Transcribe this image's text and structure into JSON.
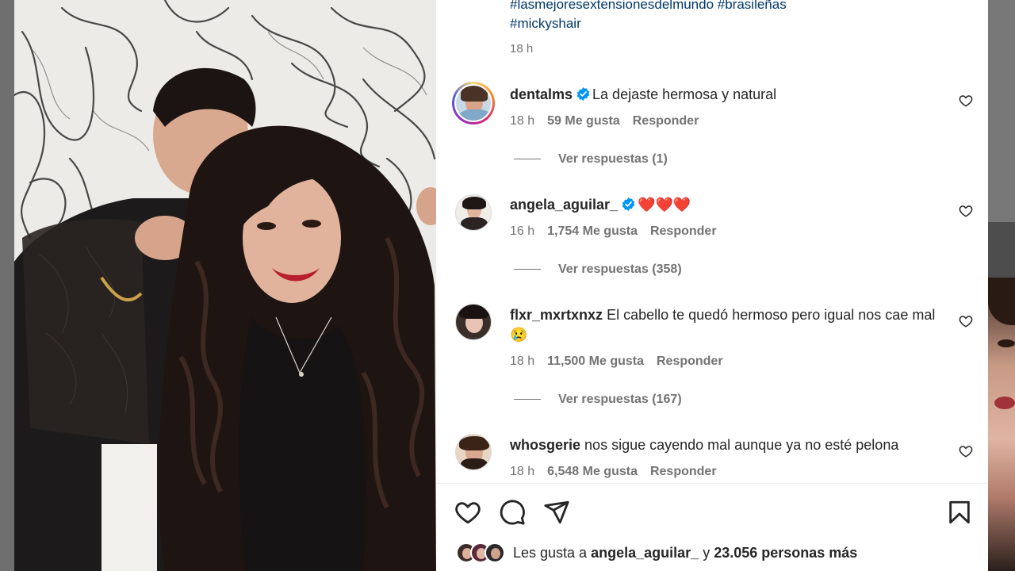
{
  "caption": {
    "hashtags": [
      "#lasmejoresextensionesdelmundo #brasileñas",
      "#mickyshair"
    ],
    "time": "18 h"
  },
  "comments": [
    {
      "username": "dentalms",
      "verified": true,
      "text": "La dejaste hermosa y natural",
      "time": "18 h",
      "likes": "59 Me gusta",
      "reply": "Responder",
      "view_replies": "Ver respuestas (1)"
    },
    {
      "username": "angela_aguilar_",
      "verified": true,
      "text": "❤️❤️❤️",
      "time": "16 h",
      "likes": "1,754 Me gusta",
      "reply": "Responder",
      "view_replies": "Ver respuestas (358)"
    },
    {
      "username": "flxr_mxrtxnxz",
      "verified": false,
      "text": "El cabello te quedó hermoso pero igual nos cae mal 😢",
      "time": "18 h",
      "likes": "11,500 Me gusta",
      "reply": "Responder",
      "view_replies": "Ver respuestas (167)"
    },
    {
      "username": "whosgerie",
      "verified": false,
      "text": "nos sigue cayendo mal aunque ya no esté pelona",
      "time": "18 h",
      "likes": "6,548 Me gusta",
      "reply": "Responder"
    }
  ],
  "likes_summary": {
    "prefix": "Les gusta a",
    "user": "angela_aguilar_",
    "connector": "y",
    "others": "23.056 personas más"
  },
  "icons": {
    "like": "heart-icon",
    "comment": "comment-icon",
    "share": "share-icon",
    "save": "bookmark-icon",
    "verified": "verified-badge-icon"
  },
  "colors": {
    "link": "#00376b",
    "secondary_text": "#737373",
    "verified": "#0095f6"
  }
}
